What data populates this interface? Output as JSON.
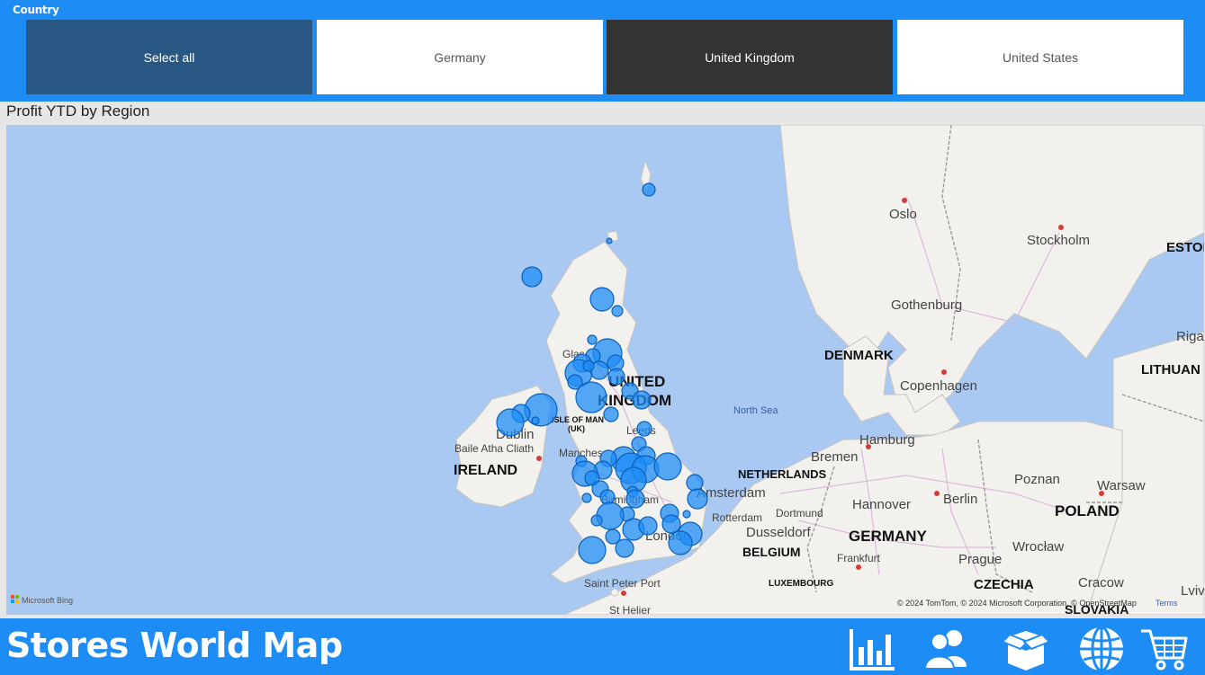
{
  "slicer": {
    "title": "Country",
    "options": [
      {
        "label": "Select all",
        "state": "partial"
      },
      {
        "label": "Germany",
        "state": "unselected"
      },
      {
        "label": "United Kingdom",
        "state": "selected"
      },
      {
        "label": "United States",
        "state": "unselected"
      }
    ]
  },
  "visual": {
    "title": "Profit YTD by Region"
  },
  "map": {
    "labels": {
      "oslo": "Oslo",
      "stockholm": "Stockholm",
      "eston": "ESTON",
      "riga": "Riga",
      "gothenburg": "Gothenburg",
      "denmark": "DENMARK",
      "copenhagen": "Copenhagen",
      "lithuan": "LITHUAN",
      "uk1": "UNITED",
      "uk2": "KINGDOM",
      "glasgow": "Glas",
      "isle_of_man1": "ISLE OF MAN",
      "isle_of_man2": "(UK)",
      "dublin": "Dublin",
      "baile": "Baile Atha Cliath",
      "ireland": "IRELAND",
      "leeds": "Leeds",
      "manchester": "Manches",
      "birmingham": "Birmingham",
      "london": "London",
      "north_sea": "North Sea",
      "hamburg": "Hamburg",
      "bremen": "Bremen",
      "netherlands": "NETHERLANDS",
      "amsterdam": "Amsterdam",
      "rotterdam": "Rotterdam",
      "dortmund": "Dortmund",
      "dusseldorf": "Dusseldorf",
      "hannover": "Hannover",
      "berlin": "Berlin",
      "poznan": "Poznan",
      "warsaw": "Warsaw",
      "poland": "POLAND",
      "germany": "GERMANY",
      "belgium": "BELGIUM",
      "luxembourg": "LUXEMBOURG",
      "frankfurt": "Frankfurt",
      "wroclaw": "Wrocław",
      "prague": "Prague",
      "czechia": "CZECHIA",
      "cracow": "Cracow",
      "slovakia": "SLOVAKIA",
      "lviv": "Lviv",
      "saint_peter_port": "Saint Peter Port",
      "st_helier": "St Helier"
    },
    "logo": "Microsoft Bing",
    "attribution": "© 2024 TomTom, © 2024 Microsoft Corporation, © OpenStreetMap",
    "terms": "Terms",
    "bubble_color": "#1e8cf5"
  },
  "footer": {
    "title": "Stores World Map",
    "nav": [
      {
        "icon": "bar-chart-icon"
      },
      {
        "icon": "users-icon"
      },
      {
        "icon": "box-icon"
      },
      {
        "icon": "globe-icon"
      },
      {
        "icon": "cart-icon"
      }
    ]
  }
}
